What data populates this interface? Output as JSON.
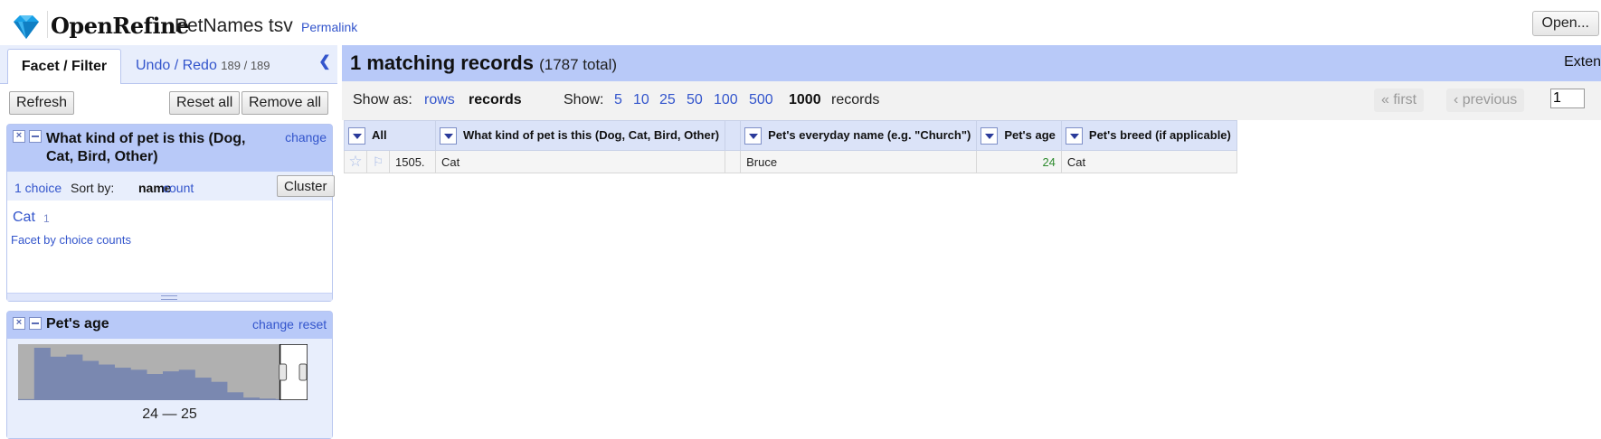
{
  "header": {
    "logo_text": "OpenRefine",
    "project_name": "PetNames tsv",
    "permalink": "Permalink",
    "open_button": "Open..."
  },
  "left_panel": {
    "tabs": {
      "facet_filter": "Facet / Filter",
      "undo_redo": "Undo / Redo",
      "undo_count": "189 / 189"
    },
    "buttons": {
      "refresh": "Refresh",
      "reset_all": "Reset all",
      "remove_all": "Remove all"
    },
    "facets": [
      {
        "title": "What kind of pet is this (Dog, Cat, Bird, Other)",
        "change": "change",
        "choice_count": "1 choice",
        "sort_by": "Sort by:",
        "sort_name": "name",
        "sort_count": "count",
        "cluster": "Cluster",
        "choices": [
          {
            "label": "Cat",
            "count": "1"
          }
        ],
        "facet_by_counts": "Facet by choice counts"
      },
      {
        "title": "Pet's age",
        "change": "change",
        "reset": "reset",
        "range": "24 — 25",
        "histogram_bins": [
          0.02,
          1.0,
          0.83,
          0.87,
          0.75,
          0.68,
          0.62,
          0.58,
          0.5,
          0.55,
          0.58,
          0.43,
          0.35,
          0.15,
          0.05,
          0.03,
          0.02,
          0.01
        ],
        "selection_fraction": [
          0.905,
          1.0
        ]
      }
    ]
  },
  "right_panel": {
    "summary_count": "1 matching records",
    "summary_total": "(1787 total)",
    "extensions": "Exten",
    "view": {
      "show_as": "Show as:",
      "rows": "rows",
      "records": "records",
      "show": "Show:",
      "page_sizes": [
        "5",
        "10",
        "25",
        "50",
        "100",
        "500",
        "1000"
      ],
      "page_size_selected": "1000",
      "page_size_suffix": "records",
      "first": "« first",
      "previous": "‹ previous",
      "page": "1"
    },
    "table": {
      "columns": [
        "All",
        "What kind of pet is this (Dog, Cat, Bird, Other)",
        "",
        "Pet's everyday name (e.g. \"Church\")",
        "Pet's age",
        "Pet's breed (if applicable)"
      ],
      "rows": [
        {
          "index": "1505.",
          "kind": "Cat",
          "empty": "",
          "name": "Bruce",
          "age": "24",
          "breed": "Cat"
        }
      ]
    }
  }
}
